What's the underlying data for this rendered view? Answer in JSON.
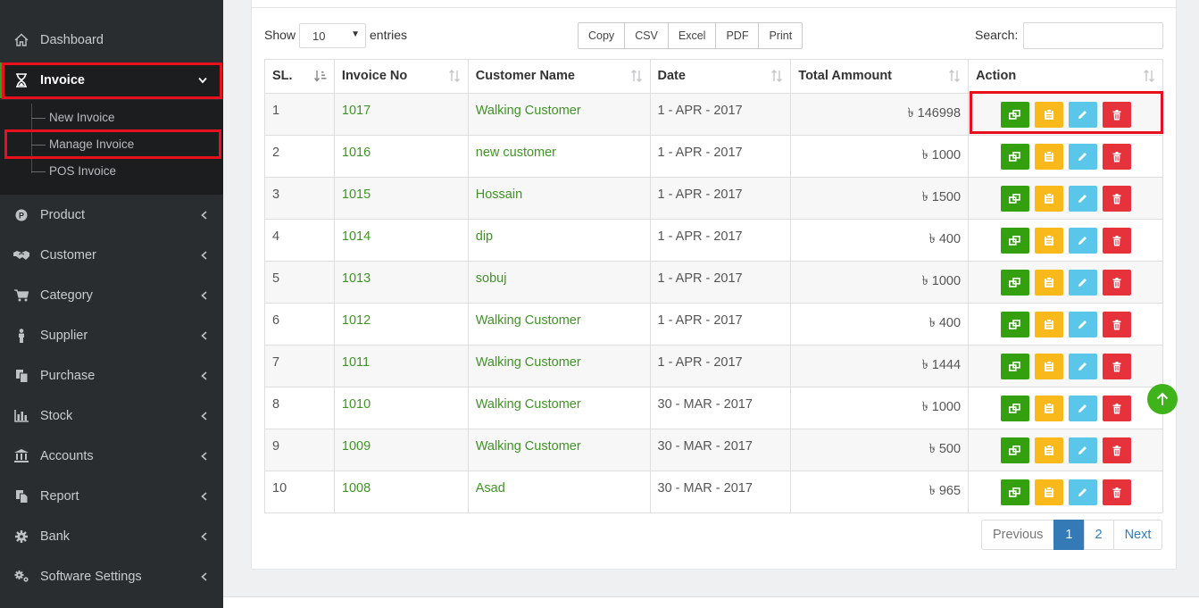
{
  "sidebar": {
    "items": [
      {
        "label": "Dashboard",
        "icon": "home-icon"
      },
      {
        "label": "Invoice",
        "icon": "hourglass-icon"
      },
      {
        "label": "Product",
        "icon": "product-p-icon"
      },
      {
        "label": "Customer",
        "icon": "handshake-icon"
      },
      {
        "label": "Category",
        "icon": "cart-icon"
      },
      {
        "label": "Supplier",
        "icon": "person-icon"
      },
      {
        "label": "Purchase",
        "icon": "copy-icon"
      },
      {
        "label": "Stock",
        "icon": "bar-chart-icon"
      },
      {
        "label": "Accounts",
        "icon": "bank-icon"
      },
      {
        "label": "Report",
        "icon": "file-icon"
      },
      {
        "label": "Bank",
        "icon": "gear-icon"
      },
      {
        "label": "Software Settings",
        "icon": "gears-icon"
      }
    ],
    "invoice_sub": [
      {
        "label": "New Invoice"
      },
      {
        "label": "Manage Invoice"
      },
      {
        "label": "POS Invoice"
      }
    ]
  },
  "controls": {
    "show_label": "Show",
    "page_length": "10",
    "entries_label": "entries",
    "export_buttons": [
      "Copy",
      "CSV",
      "Excel",
      "PDF",
      "Print"
    ],
    "search_label": "Search:",
    "search_value": ""
  },
  "table": {
    "columns": [
      "SL.",
      "Invoice No",
      "Customer Name",
      "Date",
      "Total Ammount",
      "Action"
    ],
    "currency_symbol": "৳",
    "rows": [
      {
        "sl": "1",
        "invoice": "1017",
        "customer": "Walking Customer",
        "date": "1 - APR - 2017",
        "amount": "146998"
      },
      {
        "sl": "2",
        "invoice": "1016",
        "customer": "new customer",
        "date": "1 - APR - 2017",
        "amount": "1000"
      },
      {
        "sl": "3",
        "invoice": "1015",
        "customer": "Hossain",
        "date": "1 - APR - 2017",
        "amount": "1500"
      },
      {
        "sl": "4",
        "invoice": "1014",
        "customer": "dip",
        "date": "1 - APR - 2017",
        "amount": "400"
      },
      {
        "sl": "5",
        "invoice": "1013",
        "customer": "sobuj",
        "date": "1 - APR - 2017",
        "amount": "1000"
      },
      {
        "sl": "6",
        "invoice": "1012",
        "customer": "Walking Customer",
        "date": "1 - APR - 2017",
        "amount": "400"
      },
      {
        "sl": "7",
        "invoice": "1011",
        "customer": "Walking Customer",
        "date": "1 - APR - 2017",
        "amount": "1444"
      },
      {
        "sl": "8",
        "invoice": "1010",
        "customer": "Walking Customer",
        "date": "30 - MAR - 2017",
        "amount": "1000"
      },
      {
        "sl": "9",
        "invoice": "1009",
        "customer": "Walking Customer",
        "date": "30 - MAR - 2017",
        "amount": "500"
      },
      {
        "sl": "10",
        "invoice": "1008",
        "customer": "Asad",
        "date": "30 - MAR - 2017",
        "amount": "965"
      }
    ],
    "action_buttons": [
      {
        "icon": "invoice-link-icon",
        "color": "#34a00f"
      },
      {
        "icon": "pos-print-icon",
        "color": "#f9b91a"
      },
      {
        "icon": "pencil-icon",
        "color": "#59c6ea"
      },
      {
        "icon": "trash-icon",
        "color": "#e6323b"
      }
    ]
  },
  "pagination": {
    "previous": "Previous",
    "pages": [
      "1",
      "2"
    ],
    "current": "1",
    "next": "Next"
  },
  "colors": {
    "sidebar_bg": "#2a2d2f",
    "highlight": "#e8101c",
    "link_green": "#3f9424",
    "pager_active": "#337ab7"
  }
}
